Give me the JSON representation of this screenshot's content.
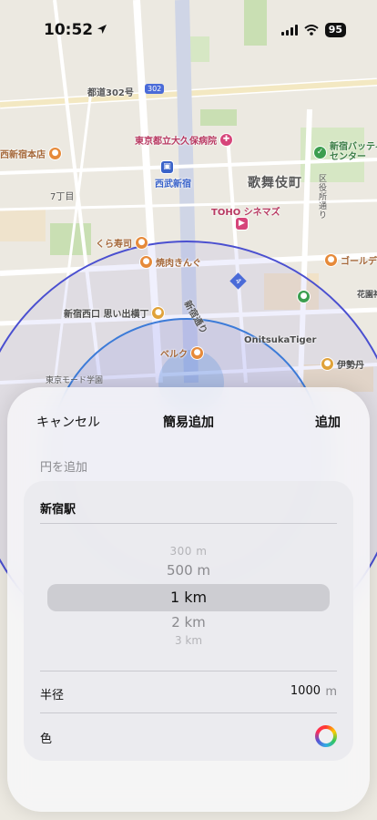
{
  "status_bar": {
    "time": "10:52",
    "battery": "95"
  },
  "map": {
    "labels": {
      "road_302": "都道302号",
      "route_302_badge": "302",
      "hospital": "東京都立大久保病院",
      "seibu_shinjuku": "西武新宿",
      "kabukicho": "歌舞伎町",
      "shinjuku_batting": "新宿バッティ\nセンター",
      "kuyakusho_dori": "区\n役\n所\n通\nり",
      "nishishinjuku_honten": "西新宿本店",
      "nanachome": "7丁目",
      "toho": "TOHO シネマズ",
      "kurazushi": "くら寿司",
      "yakiniku": "焼肉きんぐ",
      "golden": "ゴールデ",
      "route_4_badge": "4",
      "omoide": "新宿西口 思い出横丁",
      "shinjuku_dori": "新宿通り",
      "hanazono": "花園神",
      "onitsuka": "OnitsukaTiger",
      "berg": "ベルク",
      "isetan": "伊勢丹",
      "mode_gakuen": "東京モード学園"
    }
  },
  "sheet": {
    "cancel_label": "キャンセル",
    "title": "簡易追加",
    "add_label": "追加",
    "section_label": "円を追加",
    "name_value": "新宿駅",
    "picker_options": [
      "300 m",
      "500 m",
      "1 km",
      "2 km",
      "3 km"
    ],
    "picker_selected": "1 km",
    "radius_label": "半径",
    "radius_value": "1000",
    "radius_unit": "m",
    "color_label": "色"
  },
  "colors": {
    "circle_stroke": "#4a4fd0",
    "circle_fill": "#6a70e8"
  }
}
